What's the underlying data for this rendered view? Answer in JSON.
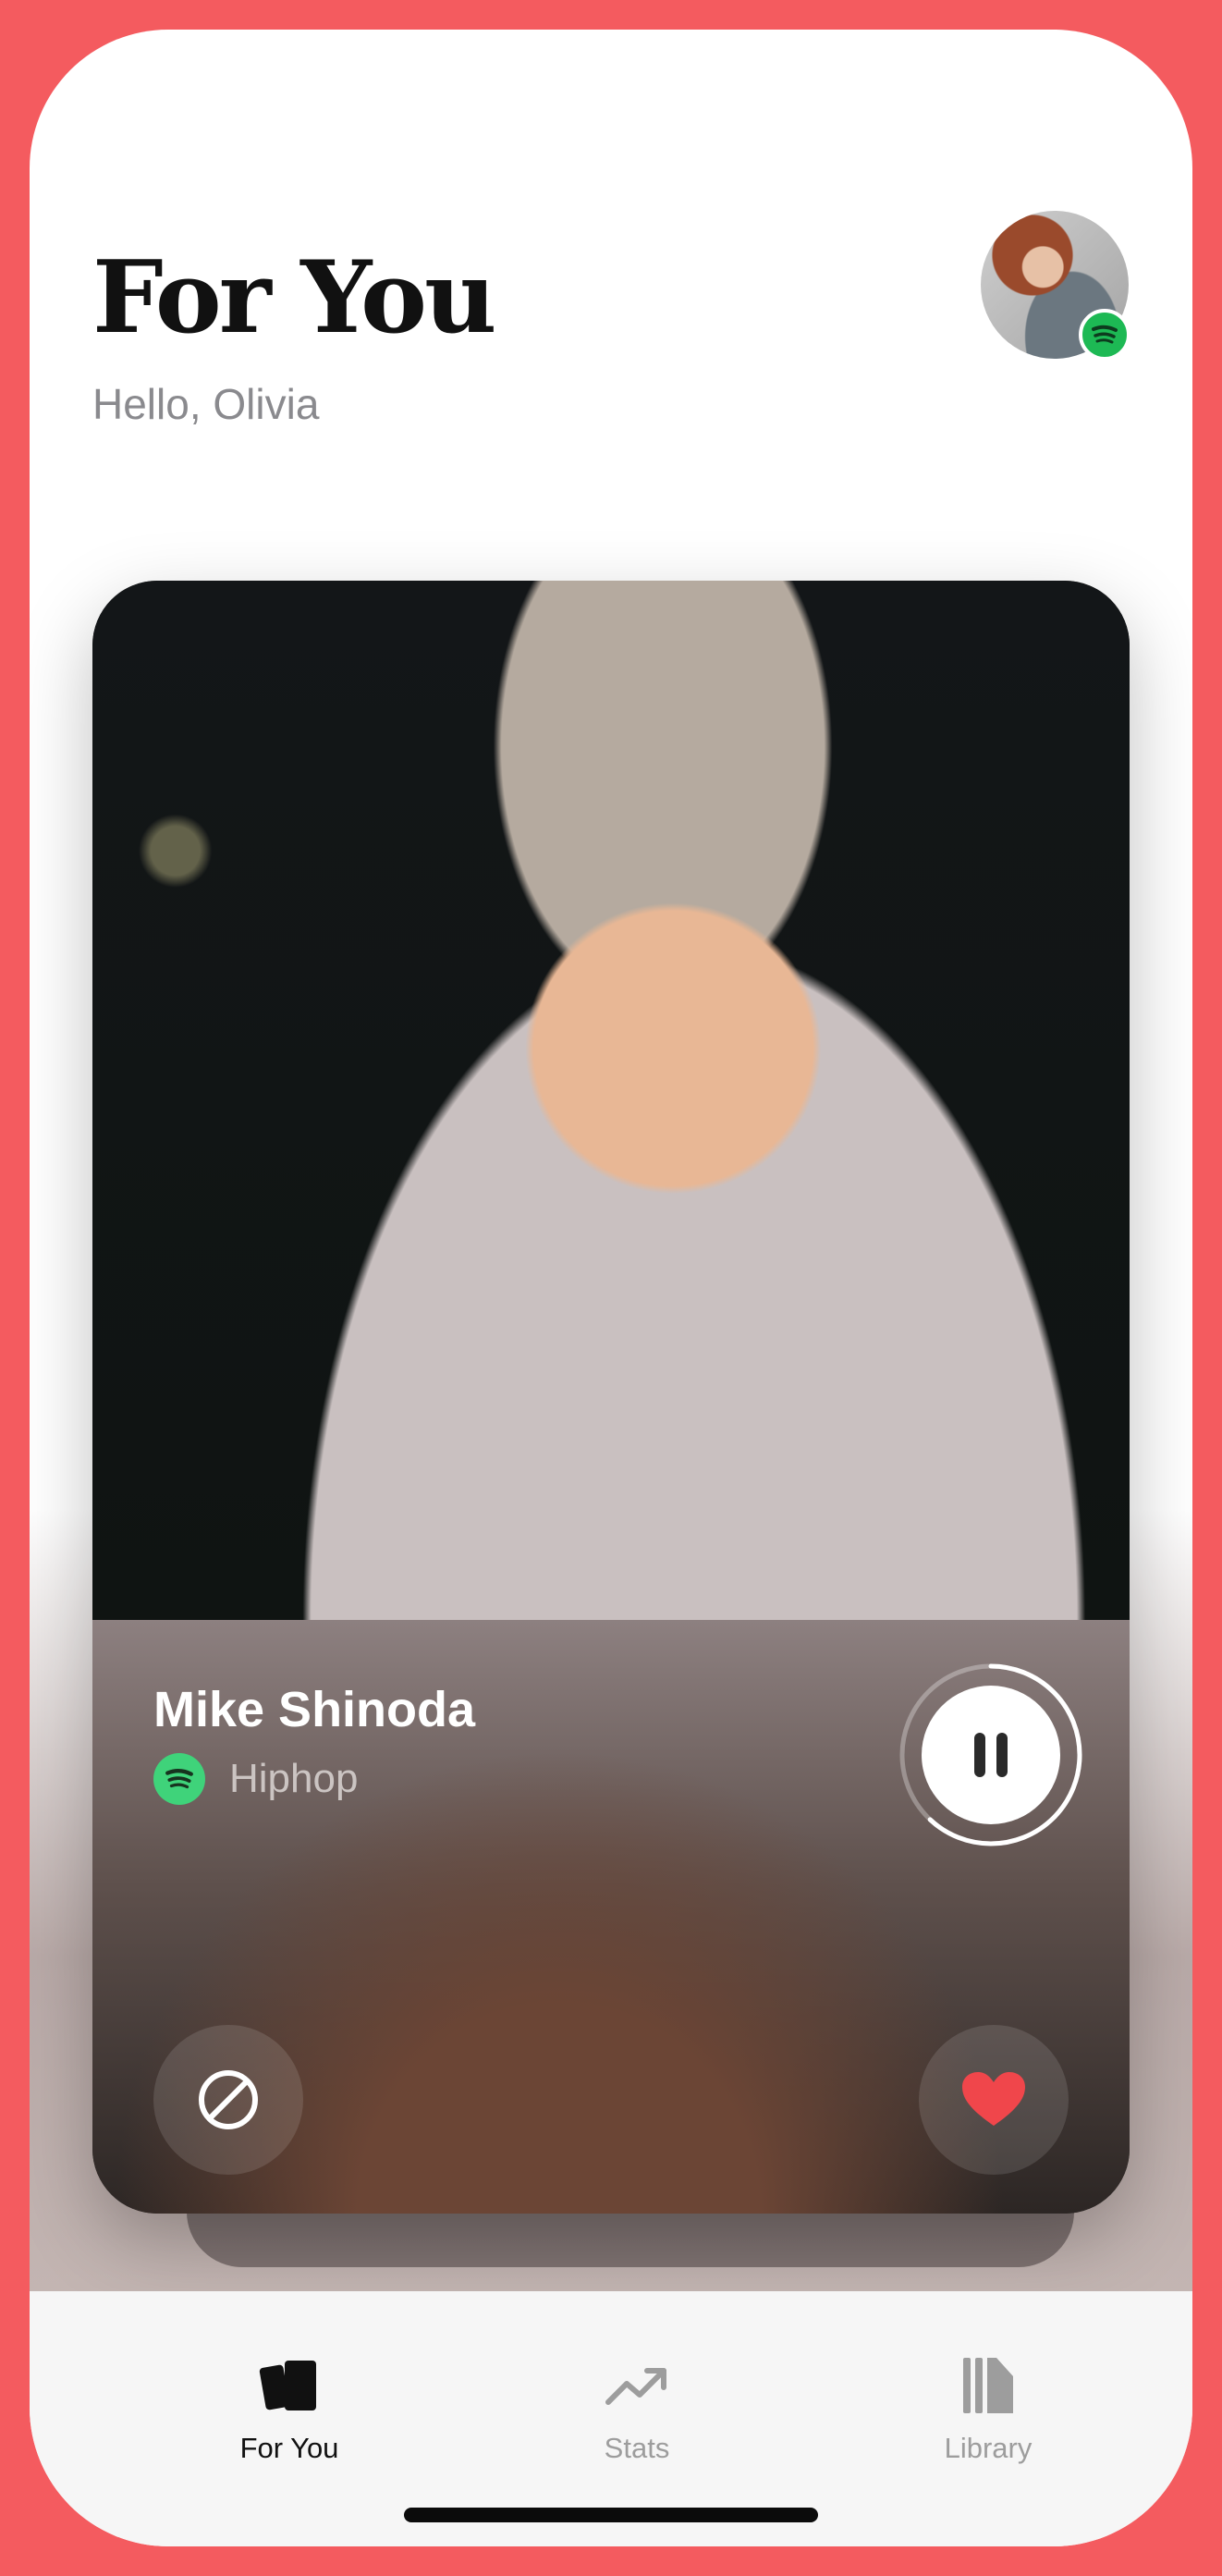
{
  "header": {
    "title": "For You",
    "greeting": "Hello, Olivia"
  },
  "profile": {
    "avatar_icon": "user-avatar",
    "badge_icon": "spotify-icon",
    "badge_color": "#1db954"
  },
  "now_playing": {
    "artist": "Mike Shinoda",
    "genre": "Hiphop",
    "source_icon": "spotify-icon",
    "playback_state": "playing",
    "progress": 0.62,
    "action_icon": "pause-icon"
  },
  "card_actions": {
    "dislike_icon": "block-icon",
    "like_icon": "heart-icon",
    "like_color": "#f0464b"
  },
  "tabs": [
    {
      "label": "For You",
      "icon": "cards-icon",
      "active": true
    },
    {
      "label": "Stats",
      "icon": "trending-up-icon",
      "active": false
    },
    {
      "label": "Library",
      "icon": "library-icon",
      "active": false
    }
  ],
  "theme": {
    "frame_color": "#f45b5f",
    "accent_color": "#f0464b"
  }
}
